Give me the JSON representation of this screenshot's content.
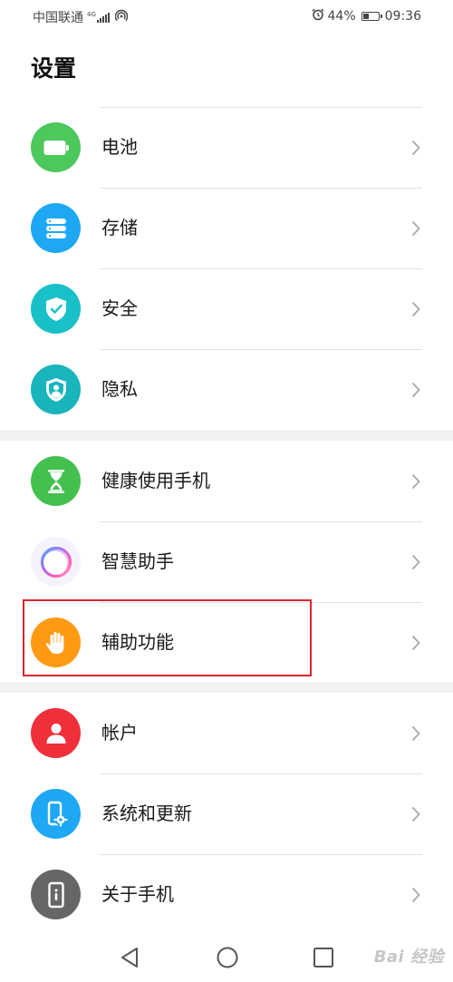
{
  "status_bar": {
    "carrier": "中国联通",
    "network_type": "4G",
    "battery_percent": "44%",
    "battery_level": 0.44,
    "time": "09:36"
  },
  "page": {
    "title": "设置"
  },
  "items": [
    {
      "label": "电池",
      "icon": "battery-icon",
      "color": "#4cc85c"
    },
    {
      "label": "存储",
      "icon": "storage-icon",
      "color": "#1ea8f4"
    },
    {
      "label": "安全",
      "icon": "shield-check-icon",
      "color": "#19c0c8"
    },
    {
      "label": "隐私",
      "icon": "privacy-shield-icon",
      "color": "#19b4bc"
    },
    {
      "label": "健康使用手机",
      "icon": "hourglass-icon",
      "color": "#44c04e"
    },
    {
      "label": "智慧助手",
      "icon": "smart-assistant-ring-icon",
      "color": "#b37cf0"
    },
    {
      "label": "辅助功能",
      "icon": "hand-icon",
      "color": "#ff9a12"
    },
    {
      "label": "帐户",
      "icon": "person-icon",
      "color": "#ef2f3a"
    },
    {
      "label": "系统和更新",
      "icon": "phone-gear-icon",
      "color": "#1ea8f4"
    },
    {
      "label": "关于手机",
      "icon": "phone-info-icon",
      "color": "#666666"
    }
  ],
  "highlight_color": "#d9262c",
  "watermark": "Bai 经验"
}
